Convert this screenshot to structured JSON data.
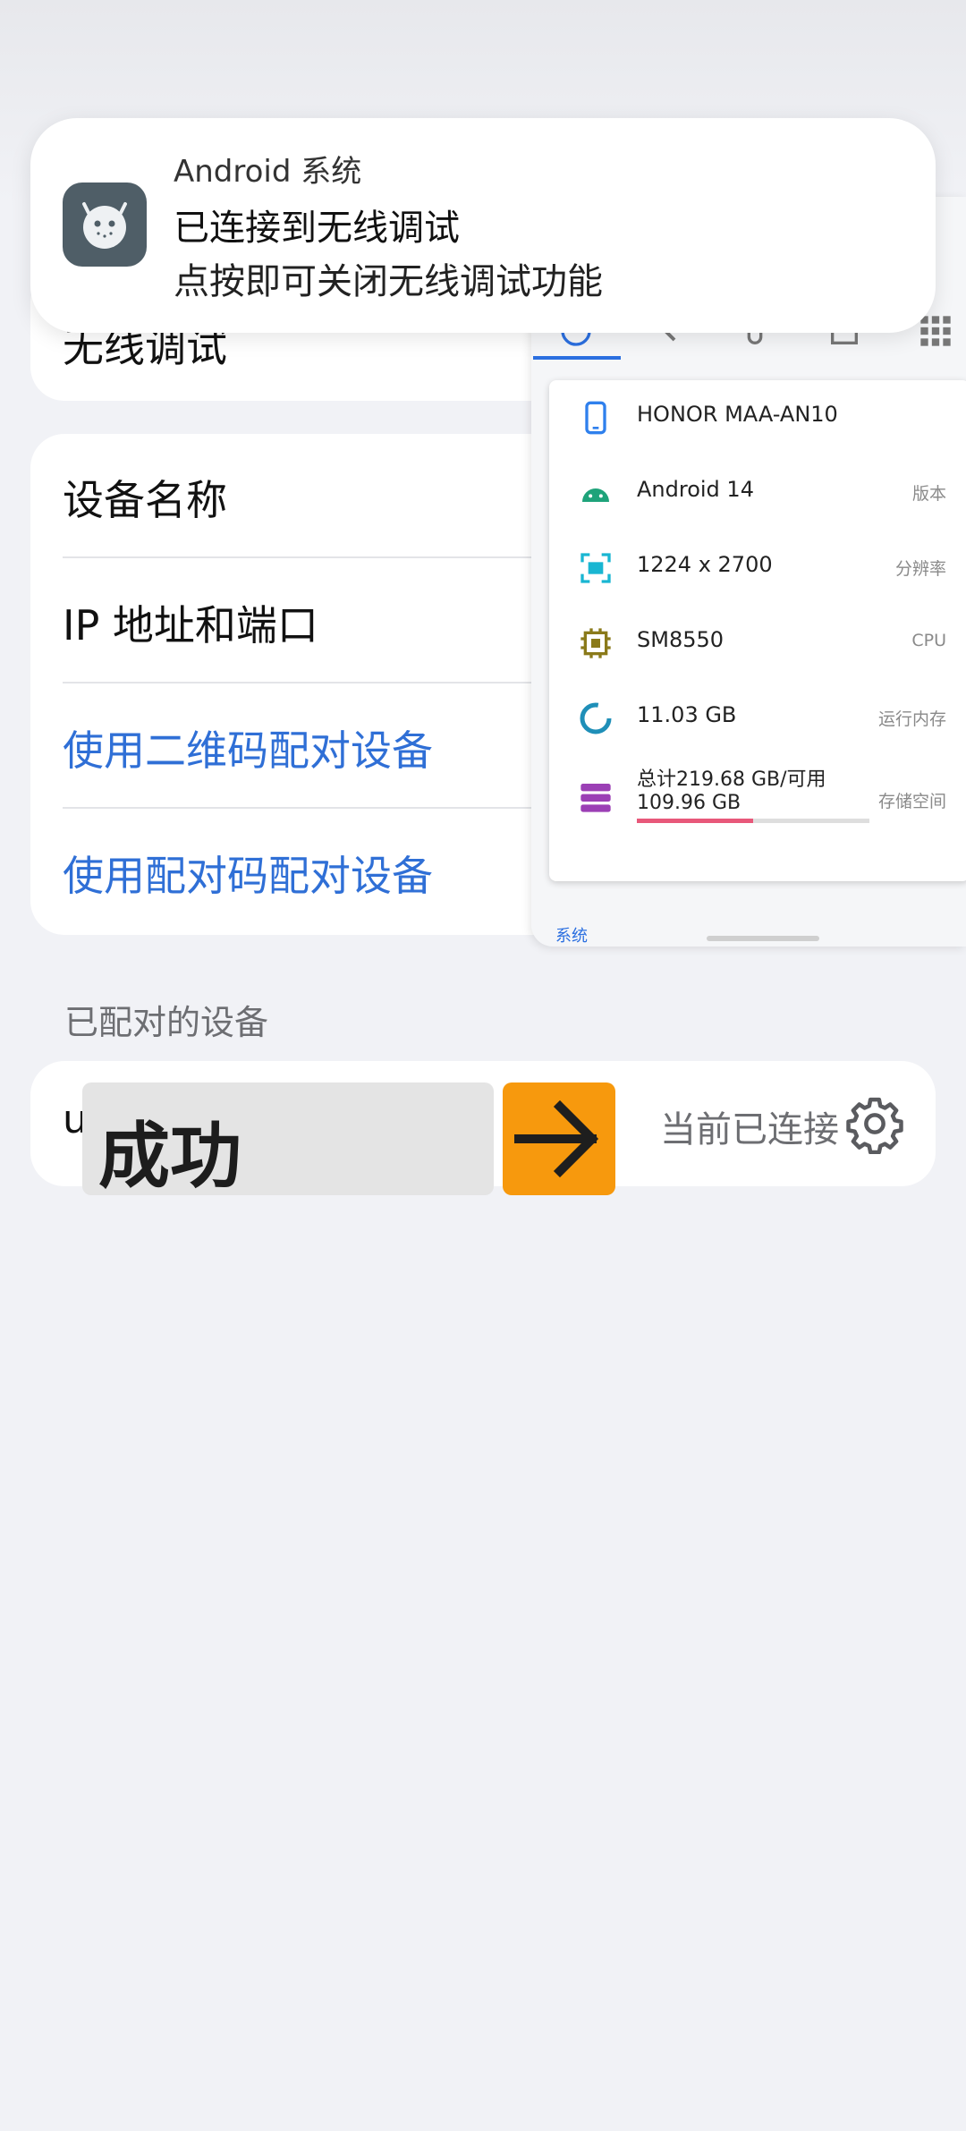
{
  "wireless_toggle": {
    "label": "无线调试"
  },
  "settings": {
    "device_name_label": "设备名称",
    "ip_port_label": "IP 地址和端口",
    "qr_pair_label": "使用二维码配对设备",
    "code_pair_label": "使用配对码配对设备"
  },
  "paired_section": {
    "title": "已配对的设备"
  },
  "paired_device": {
    "name": "u",
    "status": "当前已连接"
  },
  "overlay": {
    "success_text": "成功",
    "arrow_icon": "arrow-right-icon",
    "arrow_color": "#f7990d"
  },
  "notification": {
    "app_name": "Android 系统",
    "title": "已连接到无线调试",
    "body": "点按即可关闭无线调试功能"
  },
  "embedded_panel": {
    "rows": [
      {
        "value": "HONOR MAA-AN10",
        "tag": ""
      },
      {
        "value": "Android 14",
        "tag": "版本"
      },
      {
        "value": "1224 x 2700",
        "tag": "分辨率"
      },
      {
        "value": "SM8550",
        "tag": "CPU"
      },
      {
        "value": "11.03 GB",
        "tag": "运行内存"
      },
      {
        "value": "总计219.68 GB/可用\n109.96 GB",
        "tag": "存储空间"
      }
    ],
    "storage_used_fraction": 0.5,
    "bottom_tab": "系统"
  },
  "colors": {
    "link_blue": "#2f6fd6",
    "accent_blue": "#2b6fe0",
    "storage_bar": "#e8587a"
  }
}
